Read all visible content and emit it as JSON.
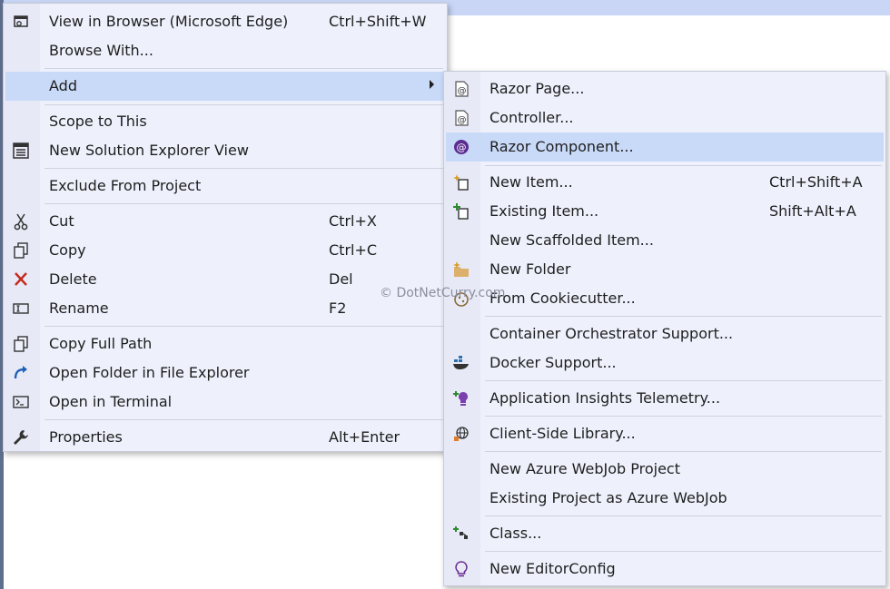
{
  "context_menu": {
    "items": [
      {
        "label": "View in Browser (Microsoft Edge)",
        "shortcut": "Ctrl+Shift+W",
        "icon": "browser-icon"
      },
      {
        "label": "Browse With...",
        "shortcut": ""
      },
      {
        "label": "Add",
        "shortcut": "",
        "highlighted": true,
        "has_submenu": true
      },
      {
        "label": "Scope to This",
        "shortcut": ""
      },
      {
        "label": "New Solution Explorer View",
        "shortcut": "",
        "icon": "solution-explorer-icon"
      },
      {
        "label": "Exclude From Project",
        "shortcut": ""
      },
      {
        "label": "Cut",
        "shortcut": "Ctrl+X",
        "icon": "scissors-icon"
      },
      {
        "label": "Copy",
        "shortcut": "Ctrl+C",
        "icon": "copy-icon"
      },
      {
        "label": "Delete",
        "shortcut": "Del",
        "icon": "delete-x-icon"
      },
      {
        "label": "Rename",
        "shortcut": "F2",
        "icon": "rename-icon"
      },
      {
        "label": "Copy Full Path",
        "shortcut": "",
        "icon": "copy-icon"
      },
      {
        "label": "Open Folder in File Explorer",
        "shortcut": "",
        "icon": "open-folder-arrow-icon"
      },
      {
        "label": "Open in Terminal",
        "shortcut": "",
        "icon": "terminal-icon"
      },
      {
        "label": "Properties",
        "shortcut": "Alt+Enter",
        "icon": "wrench-icon"
      }
    ]
  },
  "add_submenu": {
    "items": [
      {
        "label": "Razor Page...",
        "shortcut": "",
        "icon": "razor-file-icon"
      },
      {
        "label": "Controller...",
        "shortcut": "",
        "icon": "razor-file-icon"
      },
      {
        "label": "Razor Component...",
        "shortcut": "",
        "icon": "blazor-icon",
        "highlighted": true
      },
      {
        "label": "New Item...",
        "shortcut": "Ctrl+Shift+A",
        "icon": "new-item-icon"
      },
      {
        "label": "Existing Item...",
        "shortcut": "Shift+Alt+A",
        "icon": "existing-item-icon"
      },
      {
        "label": "New Scaffolded Item...",
        "shortcut": ""
      },
      {
        "label": "New Folder",
        "shortcut": "",
        "icon": "new-folder-icon"
      },
      {
        "label": "From Cookiecutter...",
        "shortcut": "",
        "icon": "cookiecutter-icon"
      },
      {
        "label": "Container Orchestrator Support...",
        "shortcut": ""
      },
      {
        "label": "Docker Support...",
        "shortcut": "",
        "icon": "docker-icon"
      },
      {
        "label": "Application Insights Telemetry...",
        "shortcut": "",
        "icon": "app-insights-icon"
      },
      {
        "label": "Client-Side Library...",
        "shortcut": "",
        "icon": "globe-icon"
      },
      {
        "label": "New Azure WebJob Project",
        "shortcut": ""
      },
      {
        "label": "Existing Project as Azure WebJob",
        "shortcut": ""
      },
      {
        "label": "Class...",
        "shortcut": "",
        "icon": "class-icon"
      },
      {
        "label": "New EditorConfig",
        "shortcut": "",
        "icon": "lightbulb-icon"
      }
    ]
  },
  "watermark": "© DotNetCurry.com",
  "colors": {
    "highlight": "#c9daf9",
    "menu_bg": "#eef1fc"
  }
}
